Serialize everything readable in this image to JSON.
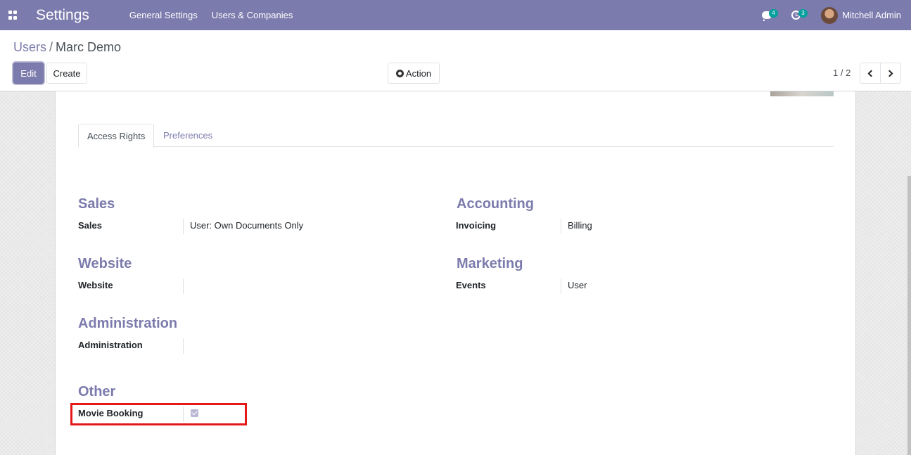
{
  "navbar": {
    "app_title": "Settings",
    "menu": [
      "General Settings",
      "Users & Companies"
    ],
    "messages_count": "4",
    "activities_count": "3",
    "user_name": "Mitchell Admin",
    "color": "#7c7bad"
  },
  "control_panel": {
    "breadcrumb_parent": "Users",
    "breadcrumb_separator": "/",
    "breadcrumb_current": "Marc Demo",
    "edit_label": "Edit",
    "create_label": "Create",
    "action_label": "Action",
    "pager_value": "1 / 2"
  },
  "tabs": [
    "Access Rights",
    "Preferences"
  ],
  "sections": {
    "sales": {
      "title": "Sales",
      "label": "Sales",
      "value": "User: Own Documents Only"
    },
    "accounting": {
      "title": "Accounting",
      "label": "Invoicing",
      "value": "Billing"
    },
    "website": {
      "title": "Website",
      "label": "Website",
      "value": ""
    },
    "marketing": {
      "title": "Marketing",
      "label": "Events",
      "value": "User"
    },
    "administration": {
      "title": "Administration",
      "label": "Administration",
      "value": ""
    },
    "other": {
      "title": "Other",
      "label": "Movie Booking",
      "checked": true
    }
  },
  "highlight_color": "#e51919"
}
